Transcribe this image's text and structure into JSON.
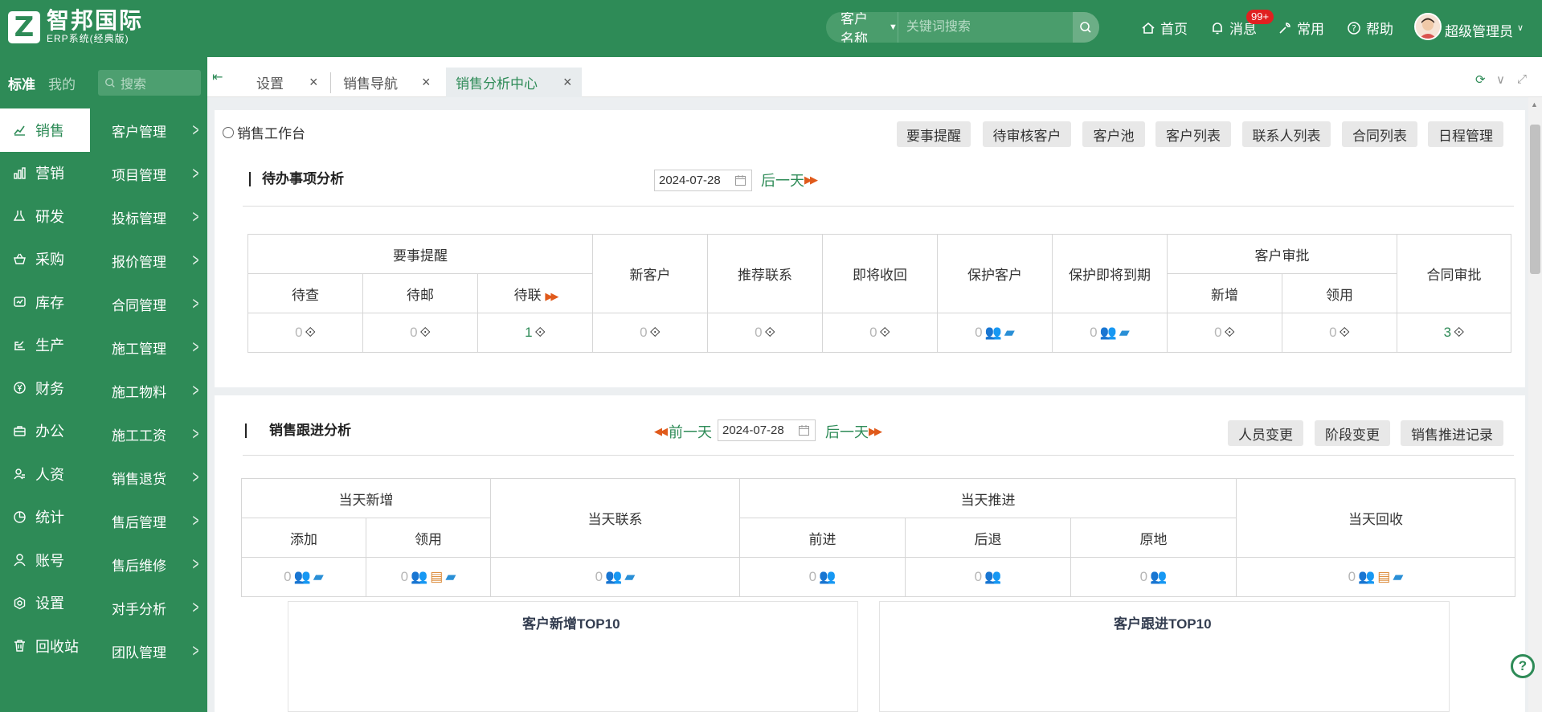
{
  "app": {
    "brand_title": "智邦国际",
    "brand_subtitle": "ERP系统(经典版)",
    "logo_letter": "Z"
  },
  "header": {
    "search_type": "客户名称",
    "search_placeholder": "关键词搜索",
    "nav": {
      "home": "首页",
      "messages": "消息",
      "messages_badge": "99+",
      "common": "常用",
      "help": "帮助"
    },
    "user_name": "超级管理员"
  },
  "sidebar": {
    "tabs": {
      "standard": "标准",
      "mine": "我的"
    },
    "search_placeholder": "搜索",
    "modules": [
      {
        "label": "销售",
        "icon": "chart-line-icon",
        "active": true
      },
      {
        "label": "营销",
        "icon": "bar-chart-icon"
      },
      {
        "label": "研发",
        "icon": "flask-icon"
      },
      {
        "label": "采购",
        "icon": "basket-icon"
      },
      {
        "label": "库存",
        "icon": "warehouse-icon"
      },
      {
        "label": "生产",
        "icon": "factory-icon"
      },
      {
        "label": "财务",
        "icon": "yen-icon"
      },
      {
        "label": "办公",
        "icon": "briefcase-icon"
      },
      {
        "label": "人资",
        "icon": "user-group-icon"
      },
      {
        "label": "统计",
        "icon": "pie-chart-icon"
      },
      {
        "label": "账号",
        "icon": "user-icon"
      },
      {
        "label": "设置",
        "icon": "gear-icon"
      },
      {
        "label": "回收站",
        "icon": "trash-icon"
      }
    ],
    "submenu": [
      "客户管理",
      "项目管理",
      "投标管理",
      "报价管理",
      "合同管理",
      "施工管理",
      "施工物料",
      "施工工资",
      "销售退货",
      "售后管理",
      "售后维修",
      "对手分析",
      "团队管理"
    ]
  },
  "tabs": [
    {
      "label": "设置"
    },
    {
      "label": "销售导航"
    },
    {
      "label": "销售分析中心",
      "active": true
    }
  ],
  "workbench": {
    "title": "销售工作台",
    "buttons": [
      "要事提醒",
      "待审核客户",
      "客户池",
      "客户列表",
      "联系人列表",
      "合同列表",
      "日程管理"
    ]
  },
  "todo": {
    "title": "待办事项分析",
    "date": "2024-07-28",
    "next_day": "后一天",
    "groups": {
      "reminders": "要事提醒",
      "new_customer": "新客户",
      "recommend": "推荐联系",
      "recall": "即将收回",
      "protect": "保护客户",
      "protect_expiring": "保护即将到期",
      "customer_approval": "客户审批",
      "contract_approval": "合同审批"
    },
    "subheaders": {
      "pending_check": "待查",
      "pending_mail": "待邮",
      "pending_contact": "待联",
      "add": "新增",
      "claim": "领用"
    },
    "values": {
      "pending_check": "0",
      "pending_mail": "0",
      "pending_contact": "1",
      "new_customer": "0",
      "recommend": "0",
      "recall": "0",
      "protect": "0",
      "protect_expiring": "0",
      "approval_add": "0",
      "approval_claim": "0",
      "contract_approval": "3"
    }
  },
  "followup": {
    "title": "销售跟进分析",
    "prev_day": "前一天",
    "date": "2024-07-28",
    "next_day": "后一天",
    "buttons": [
      "人员变更",
      "阶段变更",
      "销售推进记录"
    ],
    "groups": {
      "today_new": "当天新增",
      "today_contact": "当天联系",
      "today_advance": "当天推进",
      "today_recall": "当天回收"
    },
    "subheaders": {
      "add": "添加",
      "claim": "领用",
      "forward": "前进",
      "backward": "后退",
      "same": "原地"
    },
    "values": {
      "add": "0",
      "claim": "0",
      "contact": "0",
      "forward": "0",
      "backward": "0",
      "same": "0",
      "recall": "0"
    }
  },
  "charts": {
    "new_top10": "客户新增TOP10",
    "follow_top10": "客户跟进TOP10"
  },
  "colors": {
    "brand_green": "#2e8b57",
    "accent_orange": "#e05a1b",
    "badge_red": "#e02020"
  }
}
